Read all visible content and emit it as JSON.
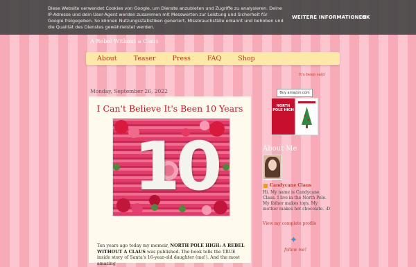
{
  "cookie_banner": {
    "message": "Diese Website verwendet Cookies von Google, um Dienste anzubieten und Zugriffe zu analysieren. Deine IP-Adresse und dein User-Agent werden zusammen mit Messwerten zur Leistung und Sicherheit für Google freigegeben. So können Nutzungsstatistiken generiert, Missbrauchsfälle erkannt und behoben und die Qualität des Dienstes gewährleistet werden.",
    "more_info": "WEITERE INFORMATIONEN",
    "ok": "OK"
  },
  "blog": {
    "subtitle": "A Rebel Without a Claus",
    "tagline": "It's been said"
  },
  "nav": {
    "items": [
      "About",
      "Teaser",
      "Press",
      "FAQ",
      "Shop"
    ]
  },
  "post": {
    "date": "Monday, September 26, 2022",
    "title": "I Can't Believe It's Been 10 Years",
    "image_text": "10",
    "body_start": "Ten years ago today my memoir, ",
    "body_bold": "NORTH POLE HIGH: A REBEL WITHOUT A CLAUS",
    "body_end": " was published. The book tells the TRUE inside story of Santa's 16-year-old daughter (me!). And the most amazing"
  },
  "sidebar": {
    "badge": "Buy amazon.com",
    "book_cover_text": "NORTH POLE HIGH",
    "about_heading": "About Me",
    "profile_name": "Candycane Claus",
    "profile_desc": "Hi. My name is Candycane Claus. I live in the North Pole. My father makes toys. My mother makes hot chocolate. :D",
    "profile_link": "View my complete profile",
    "follow": "follow me!"
  },
  "colors": {
    "accent": "#c0182b",
    "nav_bg": "#fce9a8",
    "post_bg": "#fefbee"
  }
}
